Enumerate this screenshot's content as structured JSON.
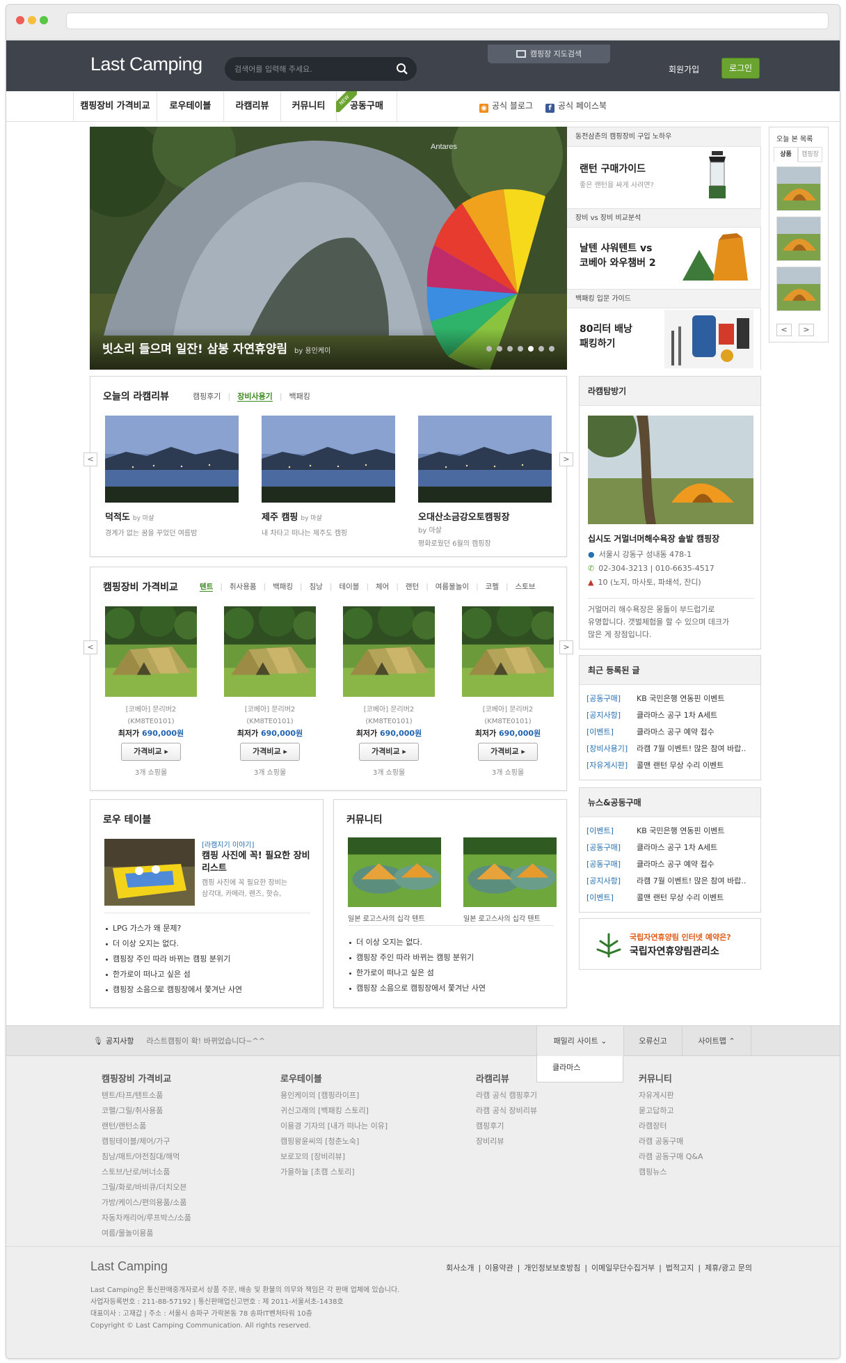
{
  "header": {
    "logo": "Last Camping",
    "search_placeholder": "검색어를 입력해 주세요.",
    "map_search": "캠핑장 지도검색",
    "join": "회원가입",
    "login": "로그인",
    "accent_color": "#6aa330"
  },
  "nav": {
    "items": [
      "캠핑장비 가격비교",
      "로우테이블",
      "라캠리뷰",
      "커뮤니티",
      "공동구매"
    ],
    "new_badge": "NEW",
    "blog": "공식 블로그",
    "facebook": "공식 페이스북"
  },
  "hero": {
    "brand": "Antares",
    "title": "빗소리 들으며 일잔! 삼봉 자연휴양림",
    "by": "by 용인케이"
  },
  "features": [
    {
      "head": "동전삼촌의 캠핑장비 구입 노하우",
      "title": "랜턴 구매가이드",
      "sub": "좋은 랜턴을 싸게 사려면?"
    },
    {
      "head": "장비 vs 장비 비교분석",
      "title_lines": [
        "날텐 샤워텐트 vs",
        "코베아 와우챔버 2"
      ]
    },
    {
      "head": "백패킹 입문 가이드",
      "title_lines": [
        "80리터 배낭",
        "패킹하기"
      ]
    }
  ],
  "recent_viewed": {
    "title": "오늘 본 목록",
    "tabs": [
      "상품",
      "캠핑장"
    ],
    "prev": "<",
    "next": ">"
  },
  "review": {
    "title": "오늘의 라캠리뷰",
    "tabs": [
      "캠핑후기",
      "장비사용기",
      "백패킹"
    ],
    "cards": [
      {
        "title": "덕적도",
        "by": "by 마샬",
        "desc": "경계가 없는 꿈을 꾸었던 여름밤"
      },
      {
        "title": "제주 캠핑",
        "by": "by 마샬",
        "desc": "내 차타고 떠나는 제주도 캠핑"
      },
      {
        "title": "오대산소금강오토캠핑장",
        "by": "by 마샬",
        "desc": "평화로웠던 6월의 캠핑장"
      }
    ]
  },
  "compare": {
    "title": "캠핑장비 가격비교",
    "tabs": [
      "텐트",
      "취사용품",
      "백패킹",
      "침낭",
      "테이블",
      "체어",
      "랜턴",
      "여름물놀이",
      "코펠",
      "스토브"
    ],
    "products": [
      {
        "name": "[코베아] 문리버2",
        "code": "(KM8TE0101)",
        "price_label": "최저가",
        "price": "690,000원",
        "button": "가격비교 ▸",
        "shops": "3개 쇼핑몰"
      },
      {
        "name": "[코베아] 문리버2",
        "code": "(KM8TE0101)",
        "price_label": "최저가",
        "price": "690,000원",
        "button": "가격비교 ▸",
        "shops": "3개 쇼핑몰"
      },
      {
        "name": "[코베아] 문리버2",
        "code": "(KM8TE0101)",
        "price_label": "최저가",
        "price": "690,000원",
        "button": "가격비교 ▸",
        "shops": "3개 쇼핑몰"
      },
      {
        "name": "[코베아] 문리버2",
        "code": "(KM8TE0101)",
        "price_label": "최저가",
        "price": "690,000원",
        "button": "가격비교 ▸",
        "shops": "3개 쇼핑몰"
      }
    ]
  },
  "lowtable": {
    "title": "로우 테이블",
    "tag": "[라캠지기 이야기]",
    "headline_lines": [
      "캠핑 사진에 꼭! 필요한 장비",
      "리스트"
    ],
    "desc_lines": [
      "캠핑 사진에 꼭 필요한 장비는",
      "삼각대, 카메라, 렌즈, 핫슈,"
    ],
    "list": [
      "LPG 가스가 왜 문제?",
      "더 이상 오지는 없다.",
      "캠핑장 주인 따라 바뀌는 캠핑 분위기",
      "한가로이 떠나고 싶은 섬",
      "캠핑장 소음으로 캠핑장에서 쫓겨난 사연"
    ]
  },
  "community": {
    "title": "커뮤니티",
    "captions": [
      "일본 로고스사의 십각 텐트",
      "일본 로고스사의 십각 텐트"
    ],
    "list": [
      "더 이상 오지는 없다.",
      "캠핑장 주인 따라 바뀌는 캠핑 분위기",
      "한가로이 떠나고 싶은 섬",
      "캠핑장 소음으로 캠핑장에서 쫓겨난 사연"
    ]
  },
  "explore": {
    "title": "라캠탐방기",
    "name": "십시도 거멀너머해수욕장 솔밭 캠핑장",
    "address": "서울시 강동구 성내동 478-1",
    "phone": "02-304-3213 | 010-6635-4517",
    "facility": "10 (노지, 마사토, 파쇄석, 잔디)",
    "desc_lines": [
      "거멀머리 해수욕장은 몽돌이 부드럽기로",
      "유명합니다. 갯벌체험을 할 수 있으며 데크가",
      "많은 게 장점입니다."
    ]
  },
  "recent_posts": {
    "title": "최근 등록된 글",
    "items": [
      {
        "tag": "[공동구매]",
        "text": "KB 국민은행 연동핀 이벤트"
      },
      {
        "tag": "[공지사항]",
        "text": "클라마스 공구 1차 A세트"
      },
      {
        "tag": "[이벤트]",
        "text": "클라마스 공구 예약 접수"
      },
      {
        "tag": "[장비사용기]",
        "text": "라캠 7월 이벤트! 많은 참여 바랍.."
      },
      {
        "tag": "[자유게시판]",
        "text": "콜맨 랜턴 무상 수리 이벤트"
      }
    ]
  },
  "news": {
    "title": "뉴스&공동구매",
    "items": [
      {
        "tag": "[이벤트]",
        "text": "KB 국민은행 연동핀 이벤트"
      },
      {
        "tag": "[공동구매]",
        "text": "클라마스 공구 1차 A세트"
      },
      {
        "tag": "[공동구매]",
        "text": "클라마스 공구 예약 접수"
      },
      {
        "tag": "[공지사항]",
        "text": "라캠 7월 이벤트! 많은 참여 바랍.."
      },
      {
        "tag": "[이벤트]",
        "text": "콜맨 랜턴 무상 수리 이벤트"
      }
    ]
  },
  "banner": {
    "line1": "국립자연휴양림 인터넷 예약은?",
    "line2": "국립자연휴양림관리소"
  },
  "footer_band": {
    "notice_label": "공지사항",
    "notice_text": "라스트캠핑이 확! 바뀌었습니다~^^",
    "family": "패밀리 사이트",
    "family_option": "클라마스",
    "report": "오류신고",
    "sitemap": "사이트맵"
  },
  "sitemap": [
    {
      "title": "캠핑장비 가격비교",
      "items": [
        "텐트/타프/텐트소품",
        "코펠/그릴/취사용품",
        "랜턴/랜턴소품",
        "캠핑테이블/체어/가구",
        "침낭/매트/야전침대/해먹",
        "스토브/난로/버너소품",
        "그릴/화로/바비큐/더치오븐",
        "가방/케이스/편의용품/소품",
        "자동차캐리어/루프박스/소품",
        "여름/물놀이용품"
      ]
    },
    {
      "title": "로우테이블",
      "items": [
        "용인케이의 [캠핑라이프]",
        "귀신고래의 [백패킹 스토리]",
        "이용경 기자의 [내가 떠나는 이유]",
        "캠핑왕윤씨의 [청춘노숙]",
        "보로꼬의 [장비리뷰]",
        "가을하늘 [초캠 스토리]"
      ]
    },
    {
      "title": "라캠리뷰",
      "items": [
        "라캠 공식 캠핑후기",
        "라캠 공식 장비리뷰",
        "캠핑후기",
        "장비리뷰"
      ]
    },
    {
      "title": "커뮤니티",
      "items": [
        "자유게시판",
        "묻고답하고",
        "라캠장터",
        "라캠 공동구매",
        "라캠 공동구매 Q&A",
        "캠핑뉴스"
      ]
    }
  ],
  "footer": {
    "logo": "Last Camping",
    "links": [
      "회사소개",
      "이용약관",
      "개인정보보호방침",
      "이메일무단수집거부",
      "법적고지",
      "제휴/광고 문의"
    ],
    "legal": [
      "Last Camping은 통신판매중개자로서 상품 주문, 배송 및 환불의 의무와 책임은 각 판매 업체에 있습니다.",
      "사업자등록번호 : 211-88-57192 | 통신판매업신고번호 : 제 2011-서울서초-1438호",
      "대표이사 : 고재갑 | 주소 : 서울시 송파구 가락본동 78 송파IT벤처타워 10층",
      "Copyright © Last Camping Communication. All rights reserved."
    ]
  }
}
